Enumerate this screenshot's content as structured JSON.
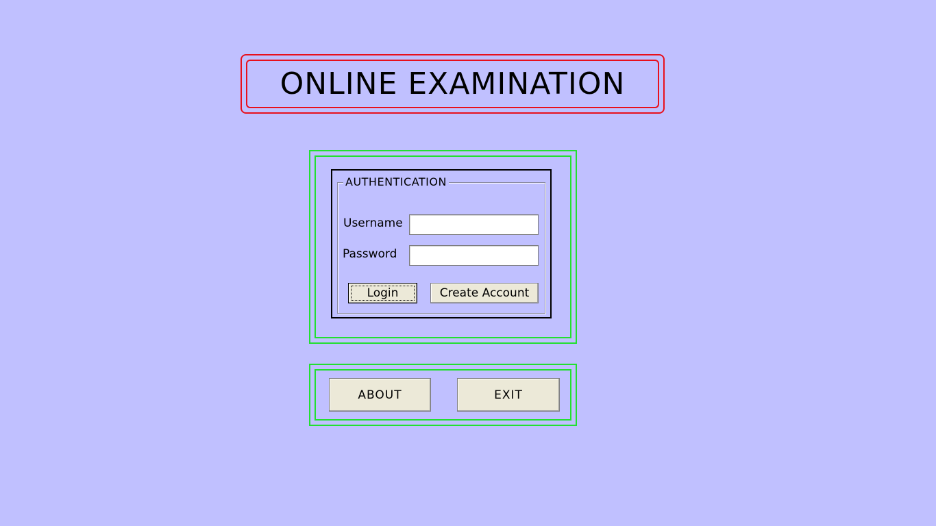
{
  "title": "ONLINE EXAMINATION",
  "authentication": {
    "legend": "AUTHENTICATION",
    "username_label": "Username",
    "username_value": "",
    "password_label": "Password",
    "password_value": "",
    "login_label": "Login",
    "create_account_label": "Create Account"
  },
  "actions": {
    "about_label": "ABOUT",
    "exit_label": "EXIT"
  },
  "colors": {
    "background": "#c0c0ff",
    "title_border": "#e8101c",
    "frame_border": "#22e030",
    "button_face": "#ece9d8"
  }
}
